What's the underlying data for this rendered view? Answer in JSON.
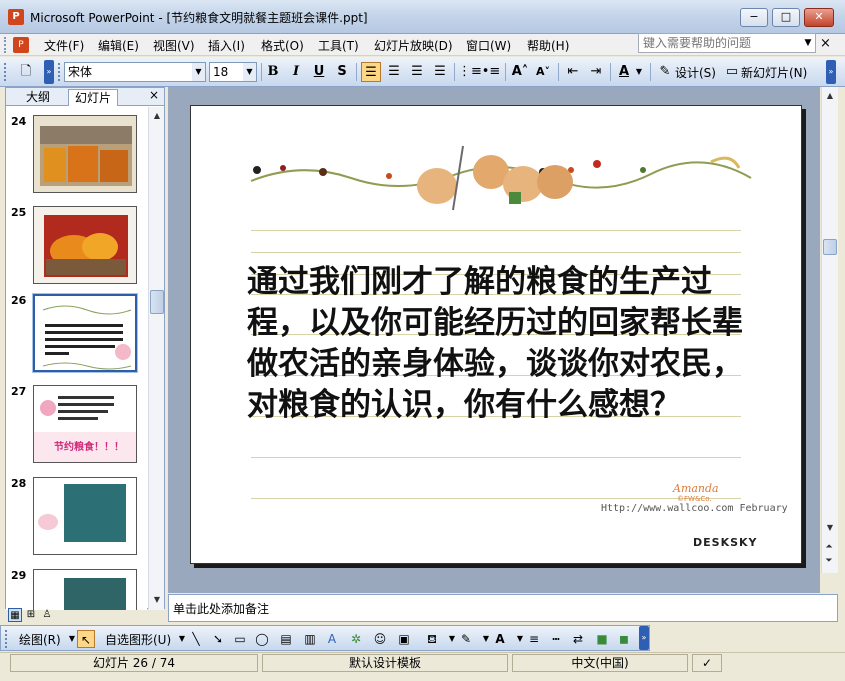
{
  "window": {
    "title": "Microsoft PowerPoint - [节约粮食文明就餐主题班会课件.ppt]",
    "app_icon": "powerpoint-icon",
    "minimize": "−",
    "maximize": "□",
    "close": "✕"
  },
  "menu": {
    "items": [
      "文件(F)",
      "编辑(E)",
      "视图(V)",
      "插入(I)",
      "格式(O)",
      "工具(T)",
      "幻灯片放映(D)",
      "窗口(W)",
      "帮助(H)"
    ],
    "help_placeholder": "键入需要帮助的问题",
    "doc_close": "×"
  },
  "toolbar": {
    "font_name": "宋体",
    "font_size": "18",
    "bold": "B",
    "italic": "I",
    "underline": "U",
    "shadow": "S",
    "design": "设计(S)",
    "new_slide": "新幻灯片(N)"
  },
  "outline_pane": {
    "tab_outline": "大纲",
    "tab_slides": "幻灯片",
    "close": "×"
  },
  "slides": [
    {
      "number": "24",
      "selected": false
    },
    {
      "number": "25",
      "selected": false
    },
    {
      "number": "26",
      "selected": true
    },
    {
      "number": "27",
      "selected": false,
      "badge": "节约粮食！！！"
    },
    {
      "number": "28",
      "selected": false
    },
    {
      "number": "29",
      "selected": false
    }
  ],
  "current_slide": {
    "body_text": "通过我们刚才了解的粮食的生产过程，以及你可能经历过的回家帮长辈做农活的亲身体验，谈谈你对农民，对粮食的认识，你有什么感想？",
    "signature": "Amanda",
    "credit_line": "©FW&Co.",
    "url_text": "Http://www.wallcoo.com February",
    "watermark": "DESKSKY"
  },
  "notes": {
    "placeholder": "单击此处添加备注"
  },
  "drawing_toolbar": {
    "draw_label": "绘图(R)",
    "autoshapes_label": "自选图形(U)"
  },
  "status": {
    "slide_indicator": "幻灯片 26 / 74",
    "template": "默认设计模板",
    "language": "中文(中国)"
  },
  "colors": {
    "slide_text": "#111111",
    "selected_thumb_border": "#2e5ea7",
    "workspace_bg": "#9aa8bd",
    "toolbar_accent": "#2f5fb3"
  }
}
